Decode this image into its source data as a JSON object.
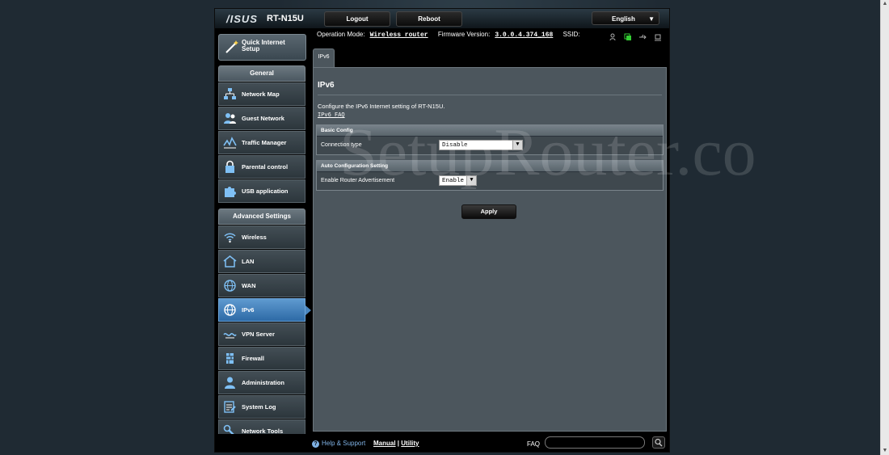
{
  "header": {
    "logo": "/ISUS",
    "model": "RT-N15U",
    "logout_label": "Logout",
    "reboot_label": "Reboot",
    "language": "English"
  },
  "status": {
    "mode_label": "Operation Mode:",
    "mode_value": "Wireless router",
    "fw_label": "Firmware Version:",
    "fw_value": "3.0.0.4.374_168",
    "ssid_label": "SSID:"
  },
  "qis": {
    "label": "Quick Internet Setup"
  },
  "sidebar": {
    "general_title": "General",
    "general": [
      {
        "label": "Network Map",
        "icon": "network-map-icon"
      },
      {
        "label": "Guest Network",
        "icon": "guest-network-icon"
      },
      {
        "label": "Traffic Manager",
        "icon": "traffic-manager-icon"
      },
      {
        "label": "Parental control",
        "icon": "lock-icon"
      },
      {
        "label": "USB application",
        "icon": "puzzle-icon"
      }
    ],
    "advanced_title": "Advanced Settings",
    "advanced": [
      {
        "label": "Wireless",
        "icon": "wifi-icon"
      },
      {
        "label": "LAN",
        "icon": "home-icon"
      },
      {
        "label": "WAN",
        "icon": "globe-icon"
      },
      {
        "label": "IPv6",
        "icon": "ipv6-globe-icon"
      },
      {
        "label": "VPN Server",
        "icon": "vpn-icon"
      },
      {
        "label": "Firewall",
        "icon": "firewall-icon"
      },
      {
        "label": "Administration",
        "icon": "admin-user-icon"
      },
      {
        "label": "System Log",
        "icon": "system-log-icon"
      },
      {
        "label": "Network Tools",
        "icon": "tools-icon"
      }
    ]
  },
  "tab": {
    "label": "IPv6"
  },
  "page": {
    "title": "IPv6",
    "description": "Configure the IPv6 Internet setting of RT-N15U.",
    "faq_link": "IPv6 FAQ"
  },
  "basic": {
    "header": "Basic Config",
    "connection_label": "Connection type",
    "connection_value": "Disable"
  },
  "auto": {
    "header": "Auto Configuration Setting",
    "ra_label": "Enable Router Advertisement",
    "ra_value": "Enable"
  },
  "apply_label": "Apply",
  "footer": {
    "help": "Help & Support",
    "manual": "Manual",
    "separator": "|",
    "utility": "Utility",
    "faq": "FAQ"
  },
  "watermark": "SetupRouter.co"
}
